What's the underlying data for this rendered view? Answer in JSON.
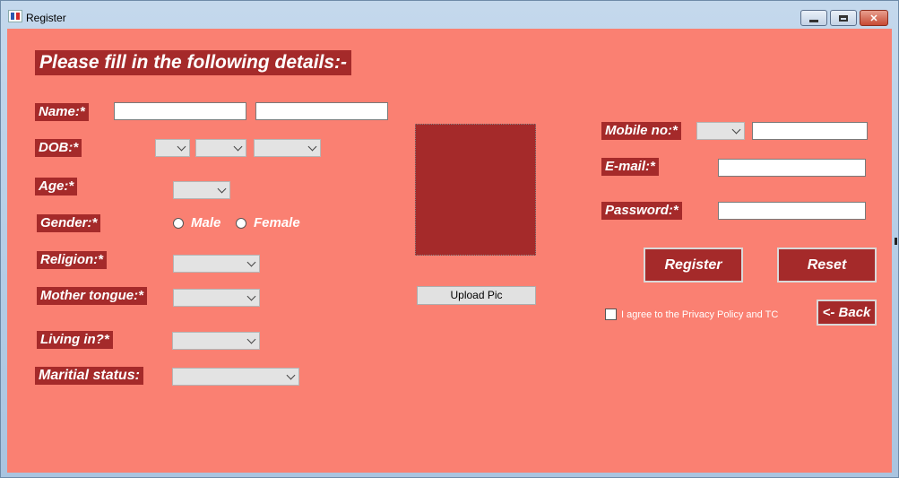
{
  "window": {
    "title": "Register"
  },
  "form": {
    "heading": "Please fill in the following details:-",
    "labels": {
      "name": "Name:*",
      "dob": "DOB:*",
      "age": "Age:*",
      "gender": "Gender:*",
      "religion": "Religion:*",
      "mother_tongue": "Mother tongue:*",
      "living_in": "Living in?*",
      "marital_status": "Maritial status:",
      "mobile": "Mobile no:*",
      "email": "E-mail:*",
      "password": "Password:*"
    },
    "fields": {
      "first_name": "",
      "last_name": "",
      "dob_day": "",
      "dob_month": "",
      "dob_year": "",
      "age": "",
      "religion": "",
      "mother_tongue": "",
      "living_in": "",
      "marital_status": "",
      "mobile_code": "",
      "mobile": "",
      "email": "",
      "password": ""
    },
    "gender_options": {
      "male": "Male",
      "female": "Female"
    },
    "upload_label": "Upload Pic",
    "register_label": "Register",
    "reset_label": "Reset",
    "back_label": "<- Back",
    "agree_label": "I agree to the Privacy Policy and TC"
  },
  "colors": {
    "background": "#fa8072",
    "label_bg": "#a52a2a"
  }
}
